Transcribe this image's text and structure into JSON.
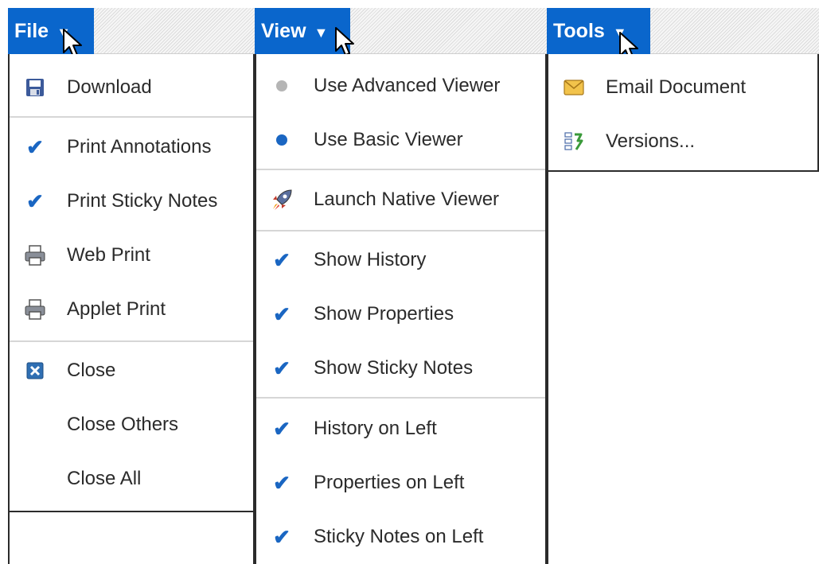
{
  "file_menu": {
    "title": "File",
    "items": [
      {
        "label": "Download"
      },
      {
        "label": "Print Annotations"
      },
      {
        "label": "Print Sticky Notes"
      },
      {
        "label": "Web Print"
      },
      {
        "label": "Applet Print"
      },
      {
        "label": "Close"
      },
      {
        "label": "Close Others"
      },
      {
        "label": "Close All"
      }
    ]
  },
  "view_menu": {
    "title": "View",
    "items": [
      {
        "label": "Use Advanced Viewer"
      },
      {
        "label": "Use Basic Viewer"
      },
      {
        "label": "Launch Native Viewer"
      },
      {
        "label": "Show History"
      },
      {
        "label": "Show Properties"
      },
      {
        "label": "Show Sticky Notes"
      },
      {
        "label": "History on Left"
      },
      {
        "label": "Properties on Left"
      },
      {
        "label": "Sticky Notes on Left"
      }
    ]
  },
  "tools_menu": {
    "title": "Tools",
    "items": [
      {
        "label": "Email Document"
      },
      {
        "label": "Versions..."
      }
    ]
  },
  "colors": {
    "menu_button_bg": "#0a66cc",
    "check": "#1a66c2",
    "radio_selected": "#1a66c2",
    "radio_unselected": "#b5b5b5",
    "text": "#2b2b2b"
  },
  "icons": [
    "save-disk-icon",
    "check-icon",
    "printer-icon",
    "close-x-icon",
    "radio-dot-icon",
    "rocket-icon",
    "envelope-icon",
    "versions-icon",
    "caret-down-icon",
    "mouse-cursor-icon"
  ]
}
